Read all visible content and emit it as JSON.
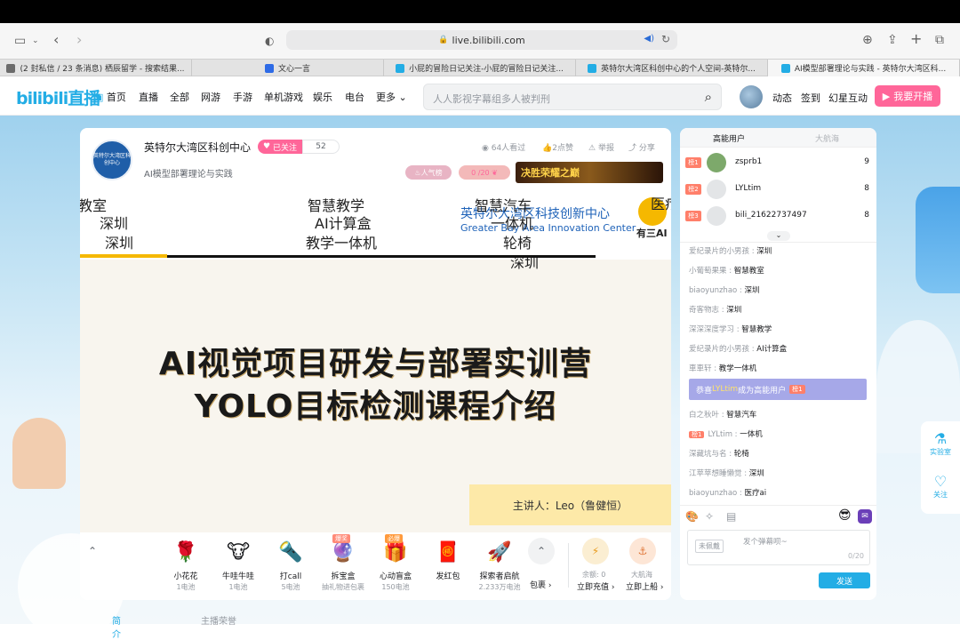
{
  "browser": {
    "url": "live.bilibili.com",
    "tabs": [
      {
        "label": "(2 封私信 / 23 条消息) 栖辰留学 - 搜索结果...",
        "color": "#6b6b6b"
      },
      {
        "label": "文心一言",
        "color": "#2e6be6"
      },
      {
        "label": "小屁的冒险日记关注-小屁的冒险日记关注...",
        "color": "#23ade5"
      },
      {
        "label": "英特尔大湾区科创中心的个人空间-英特尔...",
        "color": "#23ade5"
      },
      {
        "label": "AI模型部署理论与实践 - 英特尔大湾区科...",
        "color": "#23ade5"
      }
    ]
  },
  "header": {
    "logo": "bilibili直播",
    "nav": [
      "首页",
      "直播",
      "全部",
      "网游",
      "手游",
      "单机游戏",
      "娱乐",
      "电台",
      "更多"
    ],
    "search_placeholder": "人人影视字幕组多人被判刑",
    "right_nav": [
      "动态",
      "签到",
      "幻星互动"
    ],
    "start_live": "我要开播"
  },
  "room": {
    "avatar_text": "英特尔大湾区科创中心",
    "name": "英特尔大湾区科创中心",
    "follow_label": "已关注",
    "follow_count": "52",
    "title": "AI模型部署理论与实践",
    "viewers": "64人看过",
    "likes": "2点赞",
    "report": "举报",
    "share": "分享",
    "popularity": "人气榜",
    "progress": "0 /20",
    "banner": "决胜荣耀之巅"
  },
  "video": {
    "danmaku": [
      "教室",
      "深圳",
      "深圳",
      "智慧教学",
      "AI计算盒",
      "教学一体机",
      "智慧汽车",
      "一体机",
      "轮椅",
      "深圳",
      "医疗"
    ],
    "org_cn": "英特尔大湾区科技创新中心",
    "org_en": "Greater Bay Area Innovation Center",
    "partner": "有三AI",
    "headline1": "AI视觉项目研发与部署实训营",
    "headline2": "YOLO目标检测课程介绍",
    "speaker": "主讲人：Leo（鲁健恒）"
  },
  "gifts": [
    {
      "name": "小花花",
      "price": "1电池",
      "icon": "🌹"
    },
    {
      "name": "牛哇牛哇",
      "price": "1电池",
      "icon": "🐮"
    },
    {
      "name": "打call",
      "price": "5电池",
      "icon": "🔦"
    },
    {
      "name": "拆宝盒",
      "price": "抽礼物进包裹",
      "icon": "🔮",
      "tag": "爆奖"
    },
    {
      "name": "心动盲盒",
      "price": "150电池",
      "icon": "🎁",
      "tag": "必爆"
    },
    {
      "name": "发红包",
      "price": "",
      "icon": "🧧"
    },
    {
      "name": "探索者启航",
      "price": "2.233万电池",
      "icon": "🚀"
    }
  ],
  "package_label": "包裹",
  "balance": {
    "label": "余额: 0",
    "action": "立即充值"
  },
  "voyage": {
    "label": "大航海",
    "action": "立即上船"
  },
  "side": {
    "tab_active": "高能用户",
    "tab_other": "大航海",
    "ranks": [
      {
        "badge": "榜1",
        "name": "zsprb1",
        "score": "9"
      },
      {
        "badge": "榜2",
        "name": "LYLtim",
        "score": "8"
      },
      {
        "badge": "榜3",
        "name": "bili_21622737497",
        "score": "8"
      }
    ],
    "messages": [
      {
        "user": "爱纪录片的小男孩 : ",
        "text": "深圳"
      },
      {
        "user": "小葡萄果果 : ",
        "text": "智慧教室"
      },
      {
        "user": "biaoyunzhao : ",
        "text": "深圳"
      },
      {
        "user": "奇客物志 : ",
        "text": "深圳"
      },
      {
        "user": "深深深度学习 : ",
        "text": "智慧教学"
      },
      {
        "user": "爱纪录片的小男孩 : ",
        "text": "AI计算盒"
      },
      {
        "user": "車車轩 : ",
        "text": "教学一体机"
      }
    ],
    "system_msg": {
      "prefix": "恭喜 ",
      "user": "LYLtim",
      "suffix": " 成为高能用户",
      "badge": "榜1"
    },
    "messages2": [
      {
        "user": "白之秋叶 : ",
        "text": "智慧汽车"
      },
      {
        "user": "LYLtim : ",
        "text": "一体机",
        "badge": "榜1"
      },
      {
        "user": "深藏坑与名 : ",
        "text": "轮椅"
      },
      {
        "user": "江苹苹想睡懒觉 : ",
        "text": "深圳"
      },
      {
        "user": "biaoyunzhao : ",
        "text": "医疗ai"
      }
    ],
    "medal": "未佩戴",
    "input_placeholder": "发个弹幕呗~",
    "input_count": "0/20",
    "send": "发送"
  },
  "float": {
    "lab": "实验室",
    "follow": "关注"
  },
  "bottom_tabs": [
    "简介",
    "主播荣誉"
  ]
}
